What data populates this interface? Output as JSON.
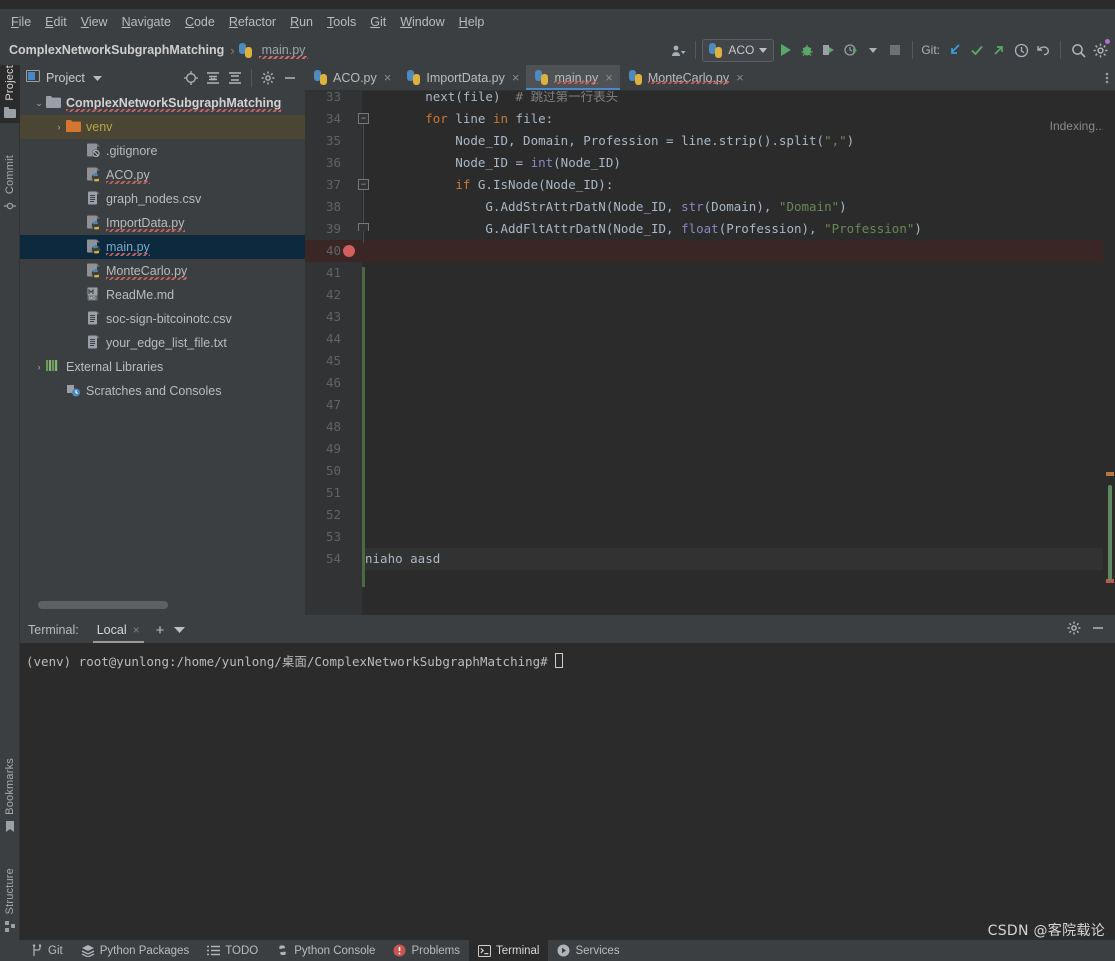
{
  "menu": {
    "items": [
      "File",
      "Edit",
      "View",
      "Navigate",
      "Code",
      "Refactor",
      "Run",
      "Tools",
      "Git",
      "Window",
      "Help"
    ]
  },
  "navbar": {
    "breadcrumbs": [
      {
        "label": "ComplexNetworkSubgraphMatching",
        "type": "project"
      },
      {
        "label": "main.py",
        "type": "file"
      }
    ],
    "separator": "›",
    "run_config": "ACO",
    "git_label": "Git:",
    "icons": [
      "account-icon",
      "python-icon",
      "chevron-down-icon",
      "run-icon",
      "debug-icon",
      "run-coverage-icon",
      "profile-icon",
      "chevron-down-icon",
      "stop-icon",
      "git-update-icon",
      "git-commit-icon",
      "git-push-icon",
      "history-icon",
      "undo-icon",
      "search-icon",
      "settings-icon"
    ]
  },
  "left_strip": {
    "top_tools": [
      {
        "label": "Project",
        "icon": "project-icon",
        "active": true
      },
      {
        "label": "Commit",
        "icon": "commit-icon",
        "active": false
      }
    ],
    "bottom_tools": [
      {
        "label": "Bookmarks",
        "icon": "bookmark-icon",
        "active": false
      },
      {
        "label": "Structure",
        "icon": "structure-icon",
        "active": false
      }
    ]
  },
  "project_panel": {
    "title": "Project",
    "caret": "▾",
    "toolbar_icons": [
      "locate-icon",
      "expand-all-icon",
      "collapse-all-icon",
      "gear-icon",
      "hide-icon"
    ],
    "tree": [
      {
        "label": "ComplexNetworkSubgraphMatching",
        "icon": "folder-icon",
        "arrow": "⌄",
        "depth": 0,
        "state": "root",
        "squiggle": true
      },
      {
        "label": "venv",
        "icon": "folder-orange-icon",
        "arrow": "›",
        "depth": 1,
        "state": "venv",
        "squiggle": false
      },
      {
        "label": ".gitignore",
        "icon": "gitignore-icon",
        "arrow": "",
        "depth": 2,
        "state": "normal",
        "squiggle": false
      },
      {
        "label": "ACO.py",
        "icon": "python-file-icon",
        "arrow": "",
        "depth": 2,
        "state": "normal",
        "squiggle": true
      },
      {
        "label": "graph_nodes.csv",
        "icon": "csv-file-icon",
        "arrow": "",
        "depth": 2,
        "state": "normal",
        "squiggle": false
      },
      {
        "label": "ImportData.py",
        "icon": "python-file-icon",
        "arrow": "",
        "depth": 2,
        "state": "normal",
        "squiggle": true
      },
      {
        "label": "main.py",
        "icon": "python-file-icon",
        "arrow": "",
        "depth": 2,
        "state": "selected",
        "squiggle": true
      },
      {
        "label": "MonteCarlo.py",
        "icon": "python-file-icon",
        "arrow": "",
        "depth": 2,
        "state": "normal",
        "squiggle": true
      },
      {
        "label": "ReadMe.md",
        "icon": "markdown-file-icon",
        "arrow": "",
        "depth": 2,
        "state": "normal",
        "squiggle": false
      },
      {
        "label": "soc-sign-bitcoinotc.csv",
        "icon": "csv-file-icon",
        "arrow": "",
        "depth": 2,
        "state": "normal",
        "squiggle": false
      },
      {
        "label": "your_edge_list_file.txt",
        "icon": "text-file-icon",
        "arrow": "",
        "depth": 2,
        "state": "normal",
        "squiggle": false
      },
      {
        "label": "External Libraries",
        "icon": "library-icon",
        "arrow": "›",
        "depth": 0,
        "state": "normal",
        "squiggle": false
      },
      {
        "label": "Scratches and Consoles",
        "icon": "scratches-icon",
        "arrow": "",
        "depth": 1,
        "state": "normal",
        "squiggle": false
      }
    ]
  },
  "editor": {
    "tabs": [
      {
        "label": "ACO.py",
        "icon": "python-file-icon",
        "active": false,
        "squiggle": false
      },
      {
        "label": "ImportData.py",
        "icon": "python-file-icon",
        "active": false,
        "squiggle": false
      },
      {
        "label": "main.py",
        "icon": "python-file-icon",
        "active": true,
        "squiggle": true
      },
      {
        "label": "MonteCarlo.py",
        "icon": "python-file-icon",
        "active": false,
        "squiggle": true
      }
    ],
    "close_glyph": "×",
    "status": "Indexing...",
    "first_line": 33,
    "lines": [
      {
        "num": 33,
        "tokens": [
          {
            "t": "        ",
            "c": "var"
          },
          {
            "t": "next",
            "c": "var"
          },
          {
            "t": "(file)  ",
            "c": "var"
          },
          {
            "t": "# 跳过第一行表头",
            "c": "cmt"
          }
        ],
        "clipped": true
      },
      {
        "num": 34,
        "tokens": [
          {
            "t": "        ",
            "c": "var"
          },
          {
            "t": "for",
            "c": "kw"
          },
          {
            "t": " line ",
            "c": "var"
          },
          {
            "t": "in",
            "c": "kw"
          },
          {
            "t": " file:",
            "c": "var"
          }
        ],
        "fold": "start"
      },
      {
        "num": 35,
        "tokens": [
          {
            "t": "            Node_ID, Domain, Profession = line.strip().split(",
            "c": "var"
          },
          {
            "t": "\",\"",
            "c": "str"
          },
          {
            "t": ")",
            "c": "var"
          }
        ]
      },
      {
        "num": 36,
        "tokens": [
          {
            "t": "            Node_ID = ",
            "c": "var"
          },
          {
            "t": "int",
            "c": "bi"
          },
          {
            "t": "(Node_ID)",
            "c": "var"
          }
        ]
      },
      {
        "num": 37,
        "tokens": [
          {
            "t": "            ",
            "c": "var"
          },
          {
            "t": "if",
            "c": "kw"
          },
          {
            "t": " G.IsNode(Node_ID):",
            "c": "var"
          }
        ],
        "fold": "start"
      },
      {
        "num": 38,
        "tokens": [
          {
            "t": "                G.AddStrAttrDatN(Node_ID, ",
            "c": "var"
          },
          {
            "t": "str",
            "c": "bi"
          },
          {
            "t": "(Domain), ",
            "c": "var"
          },
          {
            "t": "\"Domain\"",
            "c": "str"
          },
          {
            "t": ")",
            "c": "var"
          }
        ]
      },
      {
        "num": 39,
        "tokens": [
          {
            "t": "                G.AddFltAttrDatN(Node_ID, ",
            "c": "var"
          },
          {
            "t": "float",
            "c": "bi"
          },
          {
            "t": "(Profession), ",
            "c": "var"
          },
          {
            "t": "\"Profession\"",
            "c": "str"
          },
          {
            "t": ")",
            "c": "var"
          }
        ],
        "fold": "end"
      },
      {
        "num": 40,
        "tokens": [],
        "error": true,
        "breakpoint": true
      },
      {
        "num": 41,
        "tokens": []
      },
      {
        "num": 42,
        "tokens": []
      },
      {
        "num": 43,
        "tokens": []
      },
      {
        "num": 44,
        "tokens": []
      },
      {
        "num": 45,
        "tokens": []
      },
      {
        "num": 46,
        "tokens": []
      },
      {
        "num": 47,
        "tokens": []
      },
      {
        "num": 48,
        "tokens": []
      },
      {
        "num": 49,
        "tokens": []
      },
      {
        "num": 50,
        "tokens": []
      },
      {
        "num": 51,
        "tokens": []
      },
      {
        "num": 52,
        "tokens": []
      },
      {
        "num": 53,
        "tokens": []
      },
      {
        "num": 54,
        "tokens": [
          {
            "t": "niaho aasd",
            "c": "var"
          }
        ],
        "caret": true
      }
    ]
  },
  "terminal": {
    "label": "Terminal:",
    "tab": "Local",
    "close_glyph": "×",
    "add_glyph": "+",
    "chevron_glyph": "⌄",
    "header_icons": [
      "gear-icon",
      "minimize-icon"
    ],
    "prompt": "(venv) root@yunlong:/home/yunlong/桌面/ComplexNetworkSubgraphMatching#"
  },
  "statusbar": {
    "items": [
      {
        "label": "Git",
        "icon": "git-branch-icon",
        "active": false
      },
      {
        "label": "Python Packages",
        "icon": "packages-icon",
        "active": false
      },
      {
        "label": "TODO",
        "icon": "todo-icon",
        "active": false
      },
      {
        "label": "Python Console",
        "icon": "python-console-icon",
        "active": false
      },
      {
        "label": "Problems",
        "icon": "problems-icon",
        "active": false
      },
      {
        "label": "Terminal",
        "icon": "terminal-icon",
        "active": true
      },
      {
        "label": "Services",
        "icon": "services-icon",
        "active": false
      }
    ]
  },
  "watermark": "CSDN @客院载论",
  "colors": {
    "background": "#3c3f41",
    "editor_background": "#2b2b2b",
    "accent_blue": "#4a88c7",
    "selection": "#0d293e",
    "keyword": "#cc7832",
    "string": "#6a8759",
    "builtin": "#8888c6",
    "comment": "#808080",
    "error_line": "#3b2626",
    "breakpoint": "#d3605f",
    "venv_highlight": "#4b4634"
  }
}
